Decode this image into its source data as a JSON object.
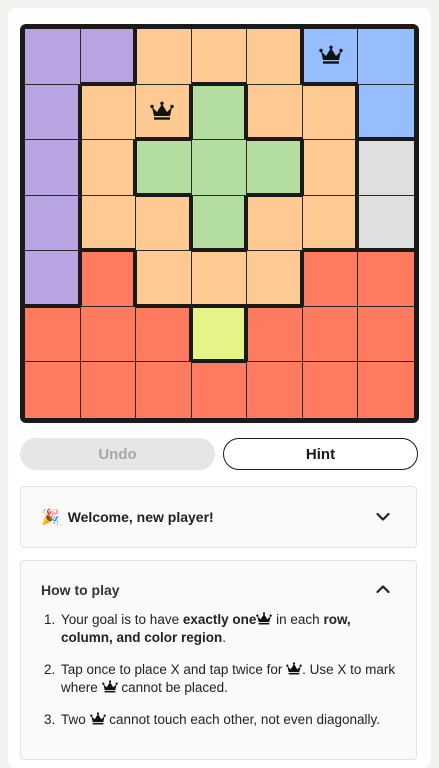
{
  "colors": {
    "purple": "#b9a3e0",
    "orange": "#ffc992",
    "blue": "#96beff",
    "green": "#b4dea0",
    "gray": "#dfdfdf",
    "red": "#ff7b60",
    "yellow": "#e5f387"
  },
  "grid": [
    [
      "purple",
      "purple",
      "orange",
      "orange",
      "orange",
      "blue",
      "blue"
    ],
    [
      "purple",
      "orange",
      "orange",
      "green",
      "orange",
      "orange",
      "blue"
    ],
    [
      "purple",
      "orange",
      "green",
      "green",
      "green",
      "orange",
      "gray"
    ],
    [
      "purple",
      "orange",
      "orange",
      "green",
      "orange",
      "orange",
      "gray"
    ],
    [
      "purple",
      "red",
      "orange",
      "orange",
      "orange",
      "red",
      "red"
    ],
    [
      "red",
      "red",
      "red",
      "yellow",
      "red",
      "red",
      "red"
    ],
    [
      "red",
      "red",
      "red",
      "red",
      "red",
      "red",
      "red"
    ]
  ],
  "queens": [
    [
      0,
      5
    ],
    [
      1,
      2
    ]
  ],
  "buttons": {
    "undo": "Undo",
    "hint": "Hint"
  },
  "welcome": {
    "emoji": "🎉",
    "title": "Welcome, new player!"
  },
  "howto": {
    "title": "How to play",
    "steps": [
      {
        "a": "Your goal is to have ",
        "b": "exactly one",
        "c": " in each ",
        "d": "row, column, and color region",
        "e": "."
      },
      {
        "a": "Tap once to place X and tap twice for",
        "b": ". Use X to mark where",
        "c": "cannot be placed."
      },
      {
        "a": "Two",
        "b": "cannot touch each other, not even diagonally."
      }
    ]
  }
}
